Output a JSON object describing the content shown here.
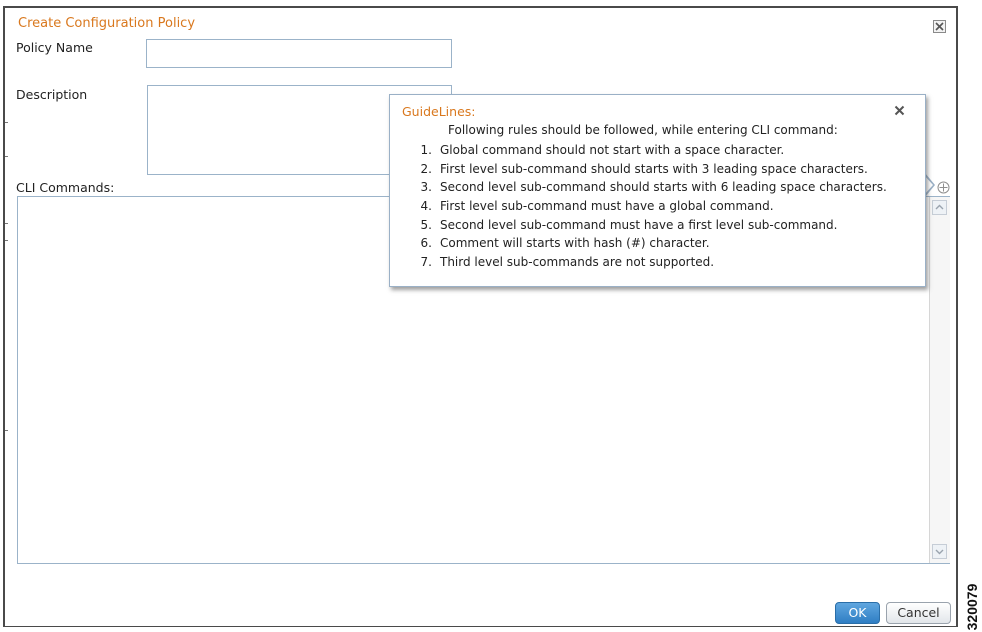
{
  "dialog": {
    "title": "Create Configuration Policy",
    "close_icon": "close-icon"
  },
  "form": {
    "policy_name_label": "Policy Name",
    "policy_name_value": "",
    "description_label": "Description",
    "description_value": "",
    "cli_commands_label": "CLI Commands:",
    "cli_commands_value": ""
  },
  "guidelines": {
    "title": "GuideLines:",
    "intro": "Following rules should be followed, while entering CLI command:",
    "rules": [
      {
        "num": "1.",
        "text": "Global command should not start with a space character."
      },
      {
        "num": "2.",
        "text": "First level sub-command should starts with 3 leading space characters."
      },
      {
        "num": "3.",
        "text": "Second level sub-command should starts with 6 leading space characters."
      },
      {
        "num": "4.",
        "text": "First level sub-command must have a global command."
      },
      {
        "num": "5.",
        "text": "Second level sub-command must have a first level sub-command."
      },
      {
        "num": "6.",
        "text": "Comment will starts with hash (#) character."
      },
      {
        "num": "7.",
        "text": "Third level sub-commands are not supported."
      }
    ]
  },
  "buttons": {
    "ok": "OK",
    "cancel": "Cancel"
  },
  "figure_id": "320079",
  "colors": {
    "title": "#d9781e",
    "ok_button": "#2f7ec4",
    "field_border": "#9bb3c9"
  }
}
